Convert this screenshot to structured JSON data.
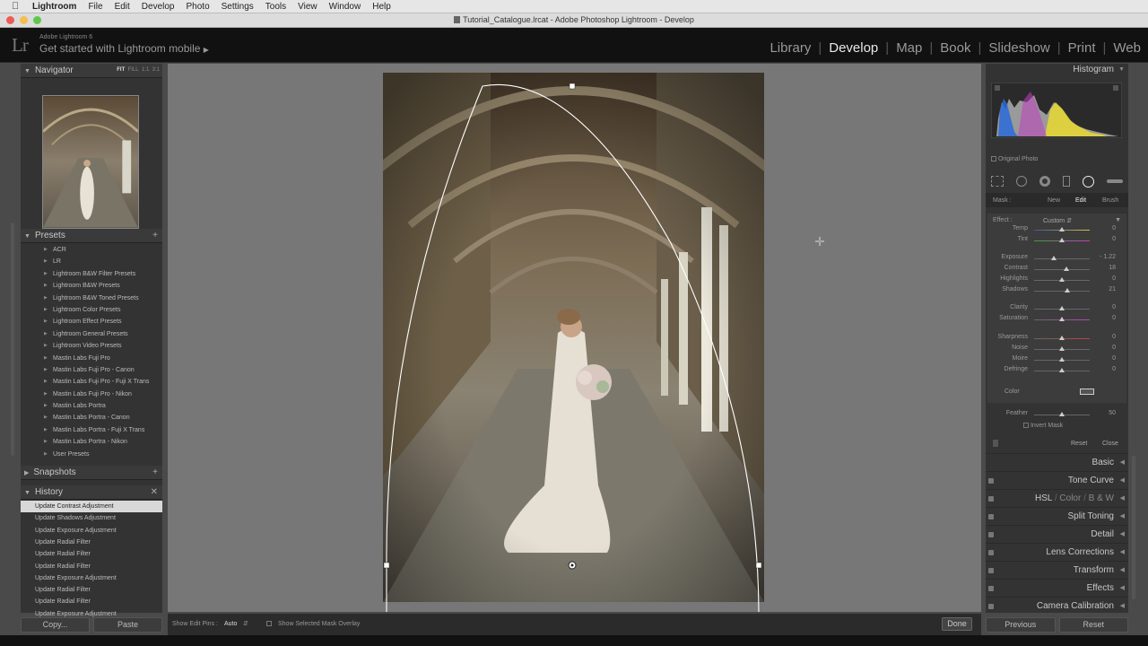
{
  "menubar": {
    "app": "Lightroom",
    "items": [
      "File",
      "Edit",
      "Develop",
      "Photo",
      "Settings",
      "Tools",
      "View",
      "Window",
      "Help"
    ]
  },
  "window": {
    "title": "Tutorial_Catalogue.lrcat - Adobe Photoshop Lightroom - Develop"
  },
  "identity": {
    "product": "Adobe Lightroom 6",
    "tagline": "Get started with Lightroom mobile"
  },
  "modules": [
    "Library",
    "Develop",
    "Map",
    "Book",
    "Slideshow",
    "Print",
    "Web"
  ],
  "active_module": "Develop",
  "navigator": {
    "title": "Navigator",
    "zoom": [
      "FIT",
      "FILL",
      "1:1",
      "3:1"
    ]
  },
  "presets": {
    "title": "Presets",
    "items": [
      "ACR",
      "LR",
      "Lightroom B&W Filter Presets",
      "Lightroom B&W Presets",
      "Lightroom B&W Toned Presets",
      "Lightroom Color Presets",
      "Lightroom Effect Presets",
      "Lightroom General Presets",
      "Lightroom Video Presets",
      "Mastin Labs Fuji Pro",
      "Mastin Labs Fuji Pro - Canon",
      "Mastin Labs Fuji Pro - Fuji X Trans",
      "Mastin Labs Fuji Pro - Nikon",
      "Mastin Labs Portra",
      "Mastin Labs Portra - Canon",
      "Mastin Labs Portra - Fuji X Trans",
      "Mastin Labs Portra - Nikon",
      "User Presets"
    ]
  },
  "snapshots": {
    "title": "Snapshots"
  },
  "history": {
    "title": "History",
    "items": [
      "Update Contrast Adjustment",
      "Update Shadows Adjustment",
      "Update Exposure Adjustment",
      "Update Radial Filter",
      "Update Radial Filter",
      "Update Radial Filter",
      "Update Exposure Adjustment",
      "Update Radial Filter",
      "Update Radial Filter",
      "Update Exposure Adjustment"
    ]
  },
  "left_buttons": {
    "copy": "Copy...",
    "paste": "Paste"
  },
  "toolbar": {
    "pins_label": "Show Edit Pins :",
    "pins_value": "Auto",
    "overlay_label": "Show Selected Mask Overlay",
    "done": "Done"
  },
  "histogram": {
    "title": "Histogram",
    "original": "Original Photo"
  },
  "mask": {
    "label": "Mask :",
    "new": "New",
    "edit": "Edit",
    "brush": "Brush"
  },
  "effect": {
    "label": "Effect :",
    "value": "Custom"
  },
  "sliders": [
    {
      "name": "Temp",
      "value": "0",
      "pos": 0.5
    },
    {
      "name": "Tint",
      "value": "0",
      "pos": 0.5
    },
    {
      "name": "Exposure",
      "value": "- 1.22",
      "pos": 0.35
    },
    {
      "name": "Contrast",
      "value": "18",
      "pos": 0.58
    },
    {
      "name": "Highlights",
      "value": "0",
      "pos": 0.5
    },
    {
      "name": "Shadows",
      "value": "21",
      "pos": 0.6
    },
    {
      "name": "Clarity",
      "value": "0",
      "pos": 0.5
    },
    {
      "name": "Saturation",
      "value": "0",
      "pos": 0.5
    },
    {
      "name": "Sharpness",
      "value": "0",
      "pos": 0.5
    },
    {
      "name": "Noise",
      "value": "0",
      "pos": 0.5
    },
    {
      "name": "Moire",
      "value": "0",
      "pos": 0.5
    },
    {
      "name": "Defringe",
      "value": "0",
      "pos": 0.5
    }
  ],
  "color_label": "Color",
  "feather": {
    "name": "Feather",
    "value": "50",
    "pos": 0.5
  },
  "invert_mask": "Invert Mask",
  "mask_buttons": {
    "reset": "Reset",
    "close": "Close"
  },
  "panels": [
    "Basic",
    "Tone Curve",
    "Split Toning",
    "Detail",
    "Lens Corrections",
    "Transform",
    "Effects",
    "Camera Calibration"
  ],
  "hsl": {
    "hsl": "HSL",
    "color": "Color",
    "bw": "B & W"
  },
  "right_buttons": {
    "previous": "Previous",
    "reset": "Reset"
  }
}
